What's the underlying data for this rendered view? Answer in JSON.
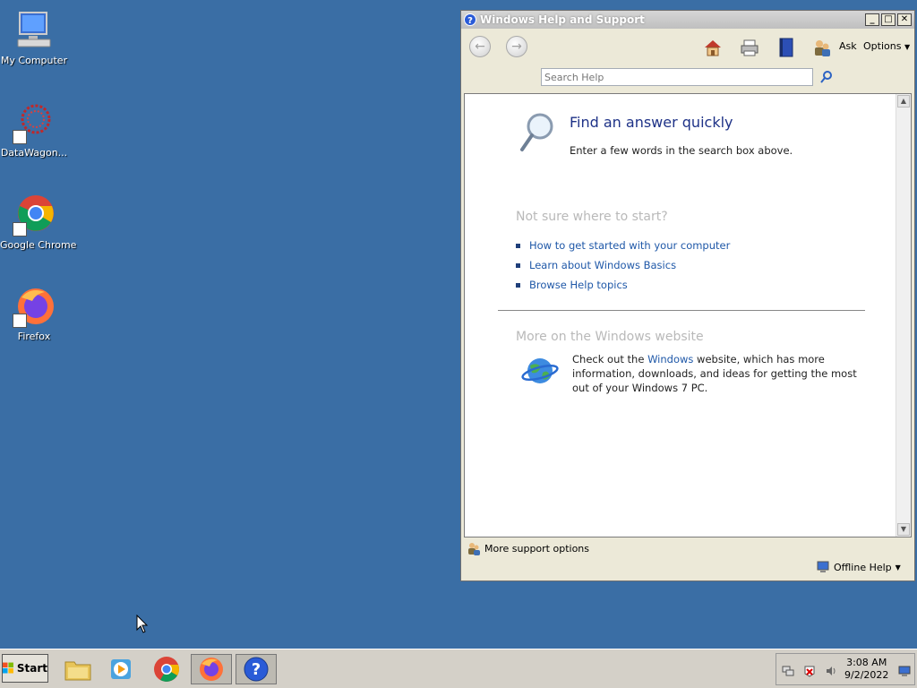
{
  "desktop": {
    "icons": [
      {
        "label": "My Computer",
        "icon": "computer-icon"
      },
      {
        "label": "DataWagon...",
        "icon": "datawagon-icon"
      },
      {
        "label": "Google Chrome",
        "icon": "chrome-icon"
      },
      {
        "label": "Firefox",
        "icon": "firefox-icon"
      }
    ]
  },
  "help_window": {
    "title": "Windows Help and Support",
    "toolbar": {
      "ask_label": "Ask",
      "options_label": "Options"
    },
    "search": {
      "placeholder": "Search Help",
      "value": ""
    },
    "find": {
      "heading": "Find an answer quickly",
      "subtext": "Enter a few words in the search box above."
    },
    "not_sure": {
      "heading": "Not sure where to start?",
      "links": [
        "How to get started with your computer",
        "Learn about Windows Basics",
        "Browse Help topics"
      ]
    },
    "website": {
      "heading": "More on the Windows website",
      "text_before": "Check out the ",
      "link": "Windows",
      "text_after": " website, which has more information, downloads, and ideas for getting the most out of your Windows 7 PC."
    },
    "more_support": "More support options",
    "offline_help": "Offline Help"
  },
  "taskbar": {
    "start_label": "Start",
    "apps": [
      "file-explorer-icon",
      "media-player-icon",
      "chrome-icon",
      "firefox-icon",
      "help-icon"
    ],
    "time": "3:08 AM",
    "date": "9/2/2022"
  },
  "colors": {
    "desktop": "#3a6ea5",
    "link": "#1f58a8",
    "heading": "#1e3287"
  }
}
